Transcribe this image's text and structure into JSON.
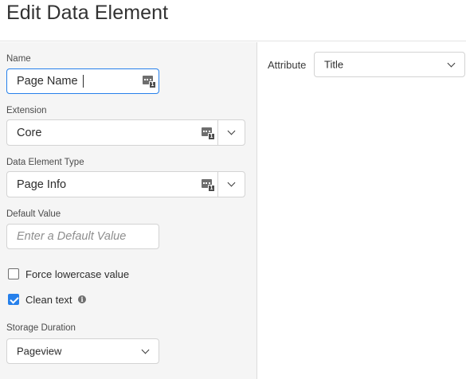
{
  "header": {
    "title": "Edit Data Element"
  },
  "form": {
    "name": {
      "label": "Name",
      "value": "Page Name"
    },
    "extension": {
      "label": "Extension",
      "value": "Core"
    },
    "data_element_type": {
      "label": "Data Element Type",
      "value": "Page Info"
    },
    "default_value": {
      "label": "Default Value",
      "placeholder": "Enter a Default Value",
      "value": ""
    },
    "force_lowercase": {
      "label": "Force lowercase value",
      "checked": false
    },
    "clean_text": {
      "label": "Clean text",
      "checked": true,
      "info_icon": "info-icon"
    },
    "storage_duration": {
      "label": "Storage Duration",
      "value": "Pageview"
    }
  },
  "settings": {
    "attribute": {
      "label": "Attribute",
      "value": "Title"
    }
  },
  "colors": {
    "accent": "#2680eb",
    "panel_bg": "#f5f5f5"
  }
}
